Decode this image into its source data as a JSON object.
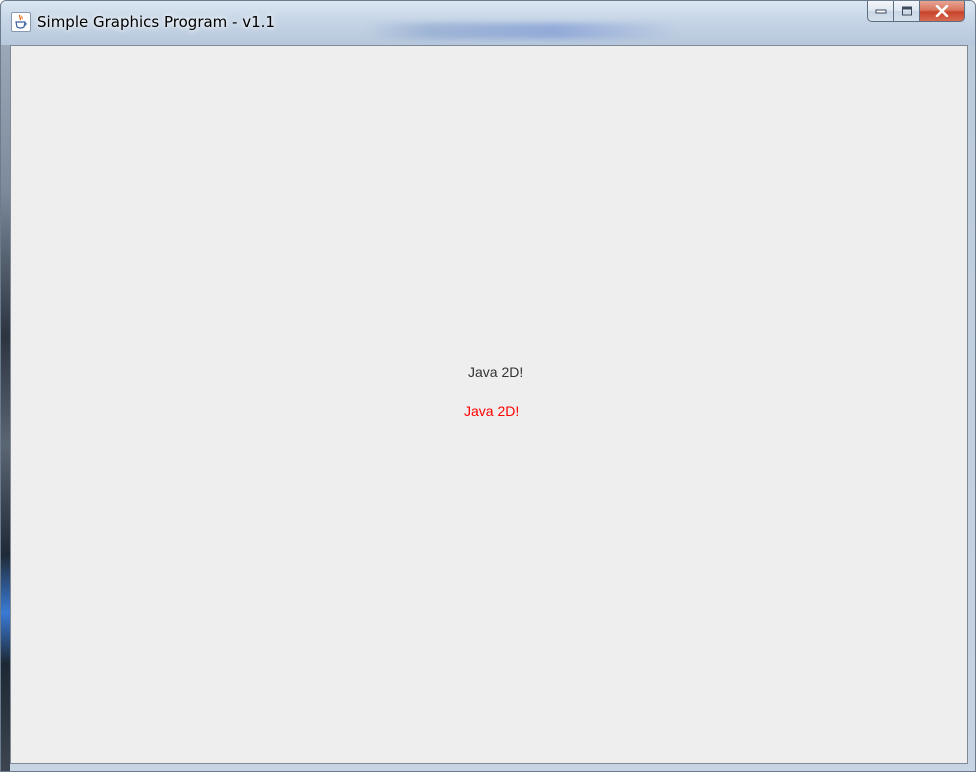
{
  "window": {
    "title": "Simple Graphics Program - v1.1",
    "icon": "java-cup-icon",
    "controls": [
      "minimize-icon",
      "maximize-icon",
      "close-icon"
    ]
  },
  "canvas": {
    "background": "#eeeeee",
    "labels": [
      {
        "text": "Java 2D!",
        "color": "#333333"
      },
      {
        "text": "Java 2D!",
        "color": "#ff0000"
      }
    ]
  },
  "colors": {
    "close_button": "#c7442a",
    "titlebar": "#c6d5e6"
  }
}
